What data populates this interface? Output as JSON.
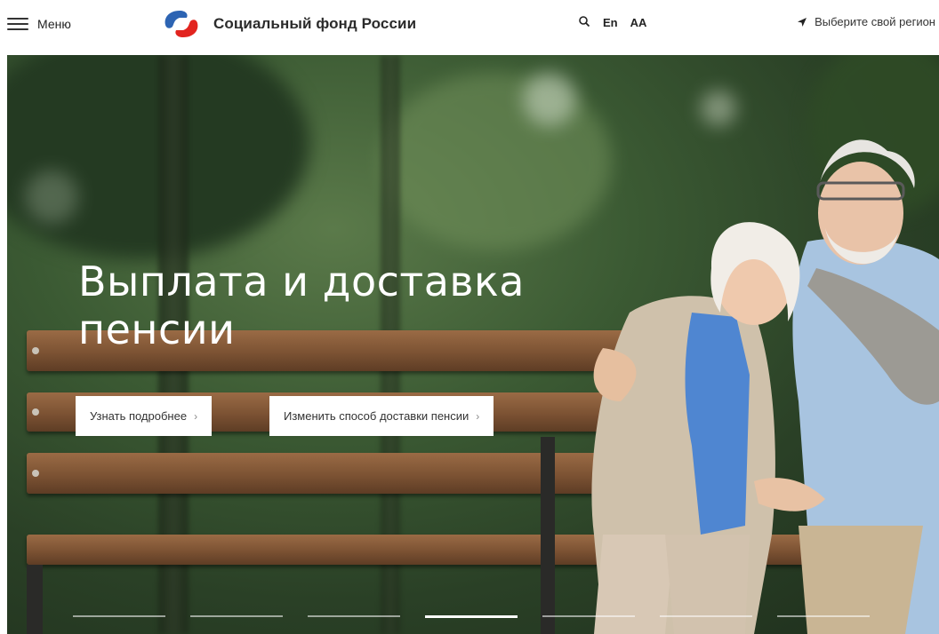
{
  "header": {
    "menu_label": "Меню",
    "logo_text": "Социальный фонд России",
    "lang_label": "En",
    "accessibility_label": "AA",
    "region_label": "Выберите свой регион"
  },
  "hero": {
    "title_line1": "Выплата и доставка",
    "title_line2": "пенсии",
    "primary_button": "Узнать подробнее",
    "secondary_button": "Изменить способ доставки пенсии",
    "slides_total": 7,
    "active_slide": 4
  },
  "colors": {
    "logo_blue": "#2d64b3",
    "logo_red": "#e2241f",
    "text_dark": "#222222"
  }
}
